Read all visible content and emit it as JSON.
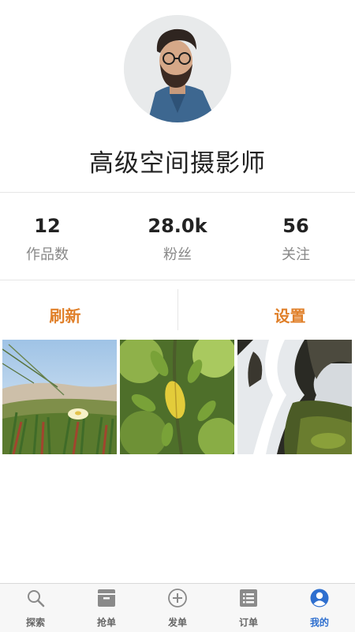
{
  "profile": {
    "name": "高级空间摄影师",
    "avatar_icon": "user-avatar"
  },
  "stats": [
    {
      "value": "12",
      "label": "作品数"
    },
    {
      "value": "28.0k",
      "label": "粉丝"
    },
    {
      "value": "56",
      "label": "关注"
    }
  ],
  "actions": {
    "refresh_label": "刷新",
    "settings_label": "设置",
    "accent_color": "#e0802a"
  },
  "photos": [
    {
      "subject": "ice-plant-flower-dune"
    },
    {
      "subject": "yellow-leaf-branch"
    },
    {
      "subject": "waterfall-mossy-rocks"
    }
  ],
  "nav": {
    "items": [
      {
        "label": "探索",
        "icon": "search-icon"
      },
      {
        "label": "抢单",
        "icon": "inbox-icon"
      },
      {
        "label": "发单",
        "icon": "plus-circle-icon"
      },
      {
        "label": "订单",
        "icon": "list-icon"
      },
      {
        "label": "我的",
        "icon": "user-icon"
      }
    ],
    "active_index": 4,
    "active_color": "#2e6fcf",
    "inactive_color": "#666666"
  }
}
